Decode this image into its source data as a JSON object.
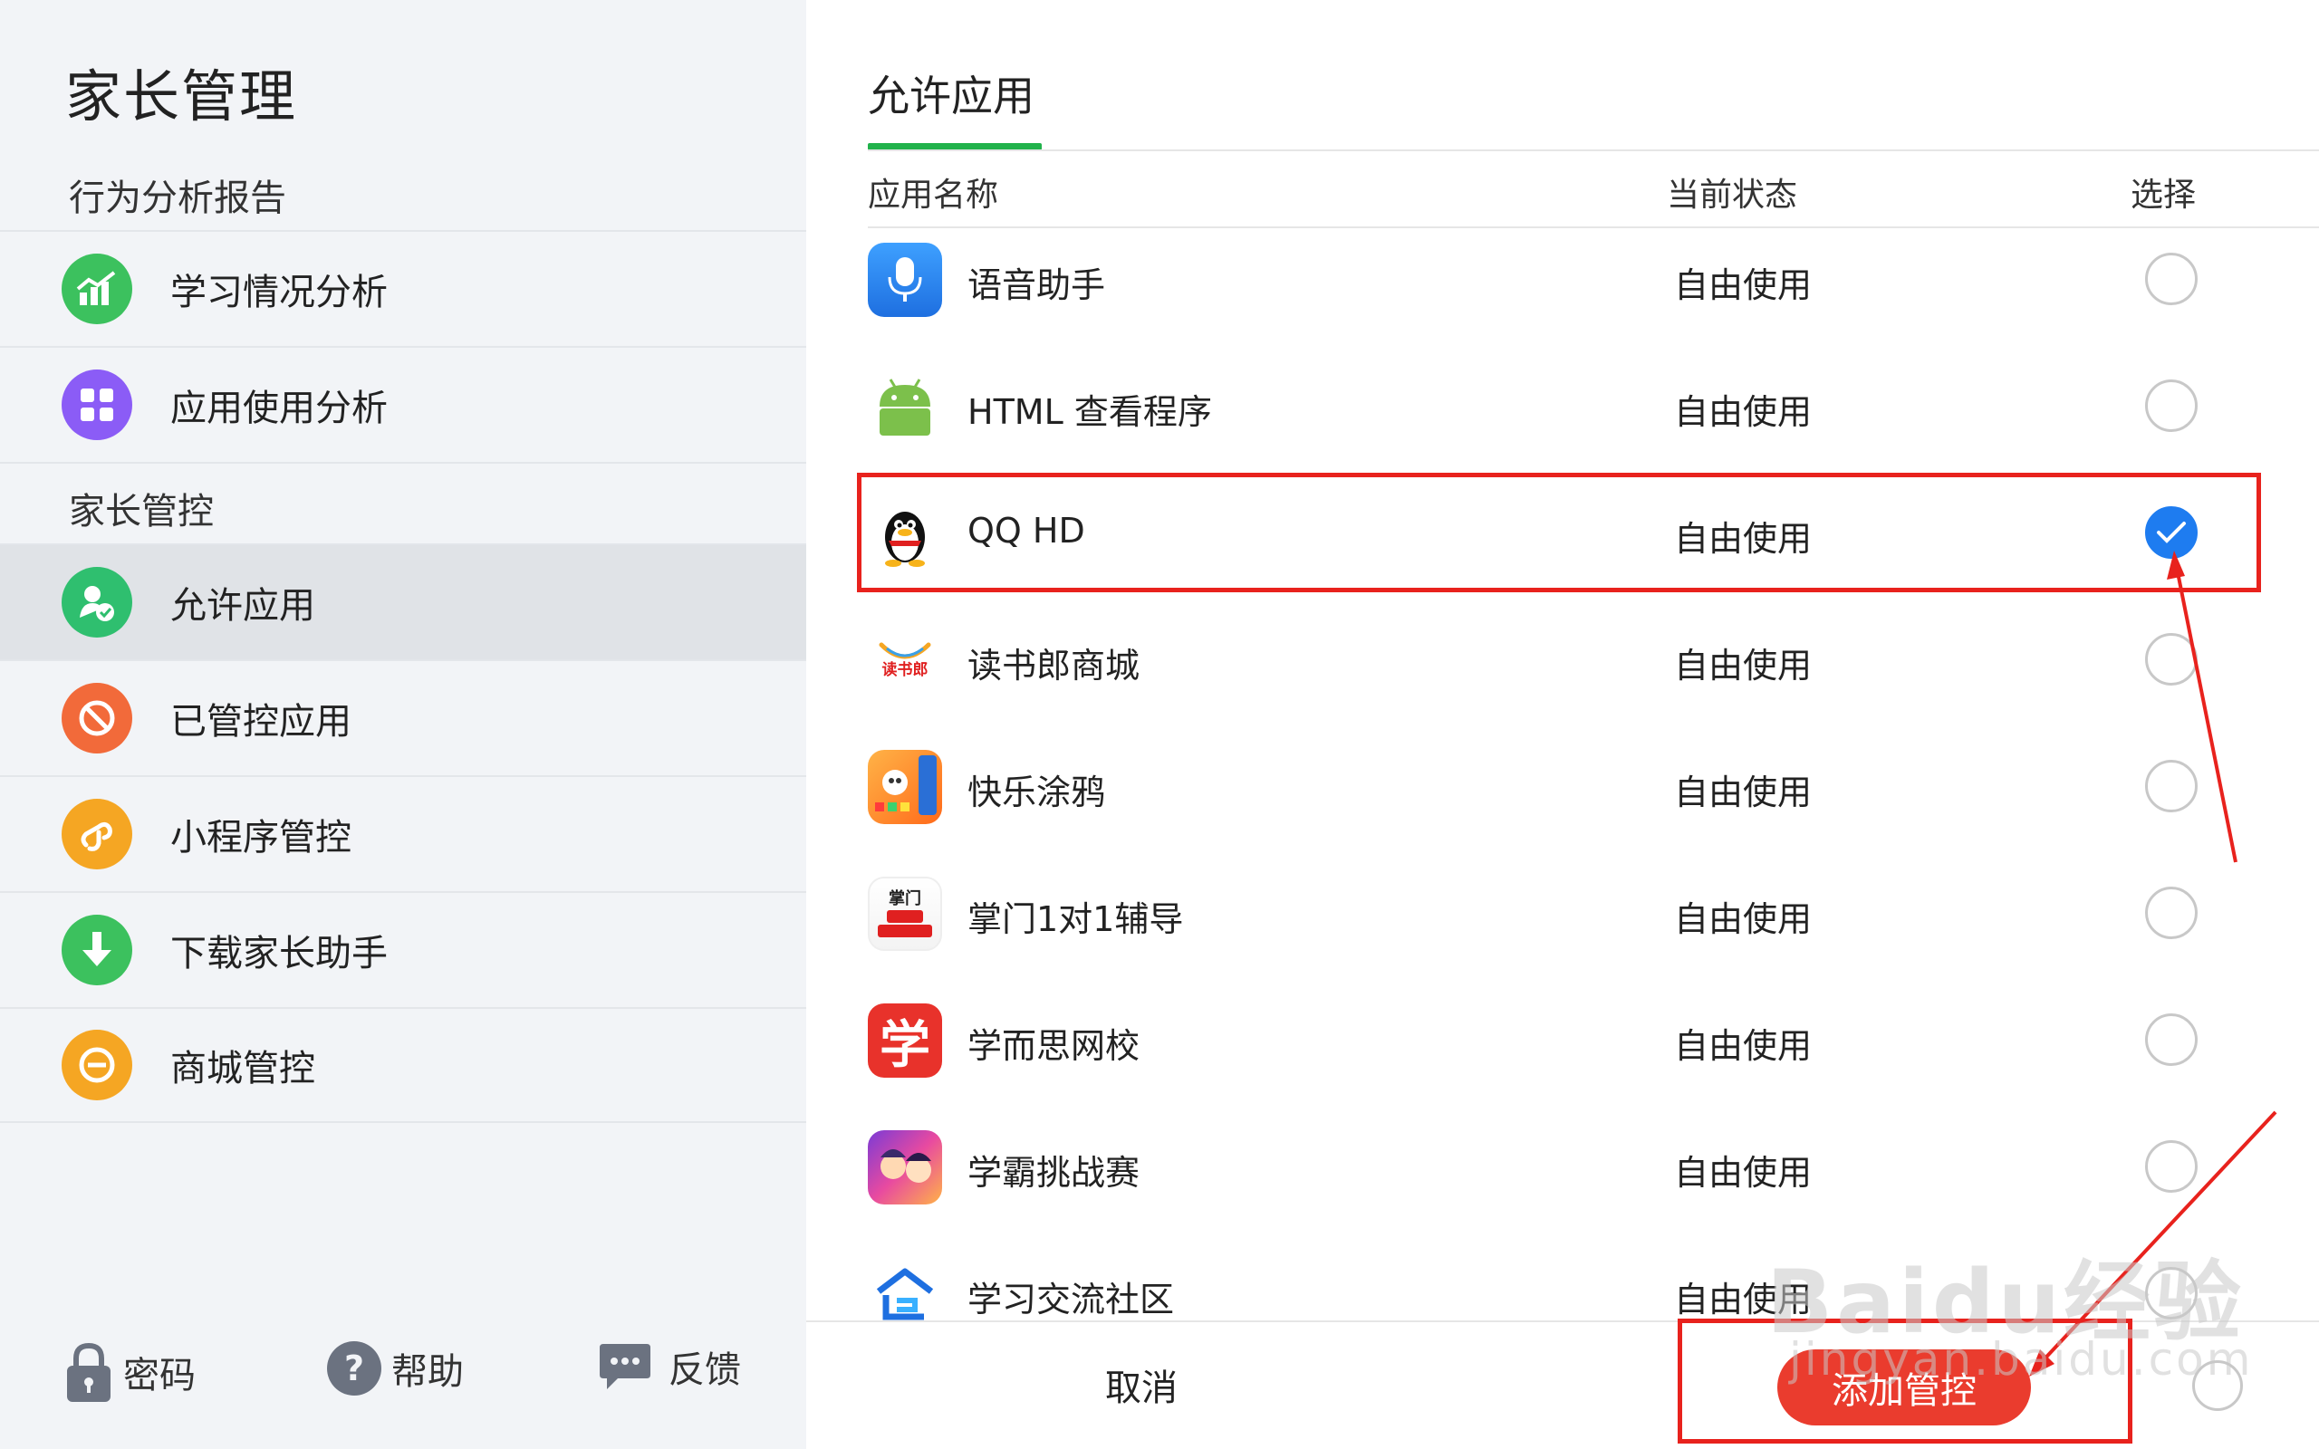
{
  "sidebar": {
    "title": "家长管理",
    "section_reports": "行为分析报告",
    "section_control": "家长管控",
    "items": [
      {
        "label": "学习情况分析",
        "icon": "chart-icon",
        "color": "#3cc15e"
      },
      {
        "label": "应用使用分析",
        "icon": "apps-grid-icon",
        "color": "#8b5cf6"
      },
      {
        "label": "允许应用",
        "icon": "user-check-icon",
        "color": "#2fbf6f"
      },
      {
        "label": "已管控应用",
        "icon": "block-icon",
        "color": "#f26a3a"
      },
      {
        "label": "小程序管控",
        "icon": "miniprogram-icon",
        "color": "#f5a623"
      },
      {
        "label": "下载家长助手",
        "icon": "download-icon",
        "color": "#3cc15e"
      },
      {
        "label": "商城管控",
        "icon": "minus-circle-icon",
        "color": "#f5a623"
      }
    ],
    "footer": {
      "password": "密码",
      "help": "帮助",
      "feedback": "反馈"
    }
  },
  "main": {
    "tab": "允许应用",
    "columns": {
      "name": "应用名称",
      "status": "当前状态",
      "select": "选择"
    },
    "apps": [
      {
        "name": "语音助手",
        "status": "自由使用",
        "checked": false,
        "icon": "microphone-icon"
      },
      {
        "name": "HTML 查看程序",
        "status": "自由使用",
        "checked": false,
        "icon": "android-icon"
      },
      {
        "name": "QQ HD",
        "status": "自由使用",
        "checked": true,
        "icon": "qq-penguin-icon"
      },
      {
        "name": "读书郎商城",
        "status": "自由使用",
        "checked": false,
        "icon": "dushulang-icon",
        "icon_text": "读书郎"
      },
      {
        "name": "快乐涂鸦",
        "status": "自由使用",
        "checked": false,
        "icon": "doodle-icon"
      },
      {
        "name": "掌门1对1辅导",
        "status": "自由使用",
        "checked": false,
        "icon": "zhangmen-icon",
        "icon_text": "掌门"
      },
      {
        "name": "学而思网校",
        "status": "自由使用",
        "checked": false,
        "icon": "xueersi-icon",
        "icon_text": "学"
      },
      {
        "name": "学霸挑战赛",
        "status": "自由使用",
        "checked": false,
        "icon": "game-icon"
      },
      {
        "name": "学习交流社区",
        "status": "自由使用",
        "checked": false,
        "icon": "community-icon"
      }
    ],
    "cancel": "取消",
    "add": "添加管控"
  },
  "watermark": {
    "line1": "Baidu经验",
    "line2": "jingyan.baidu.com"
  },
  "colors": {
    "accent_green": "#21b24b",
    "check_blue": "#1e7cf0",
    "add_red": "#ea3c2e",
    "annotation_red": "#e8221d"
  }
}
